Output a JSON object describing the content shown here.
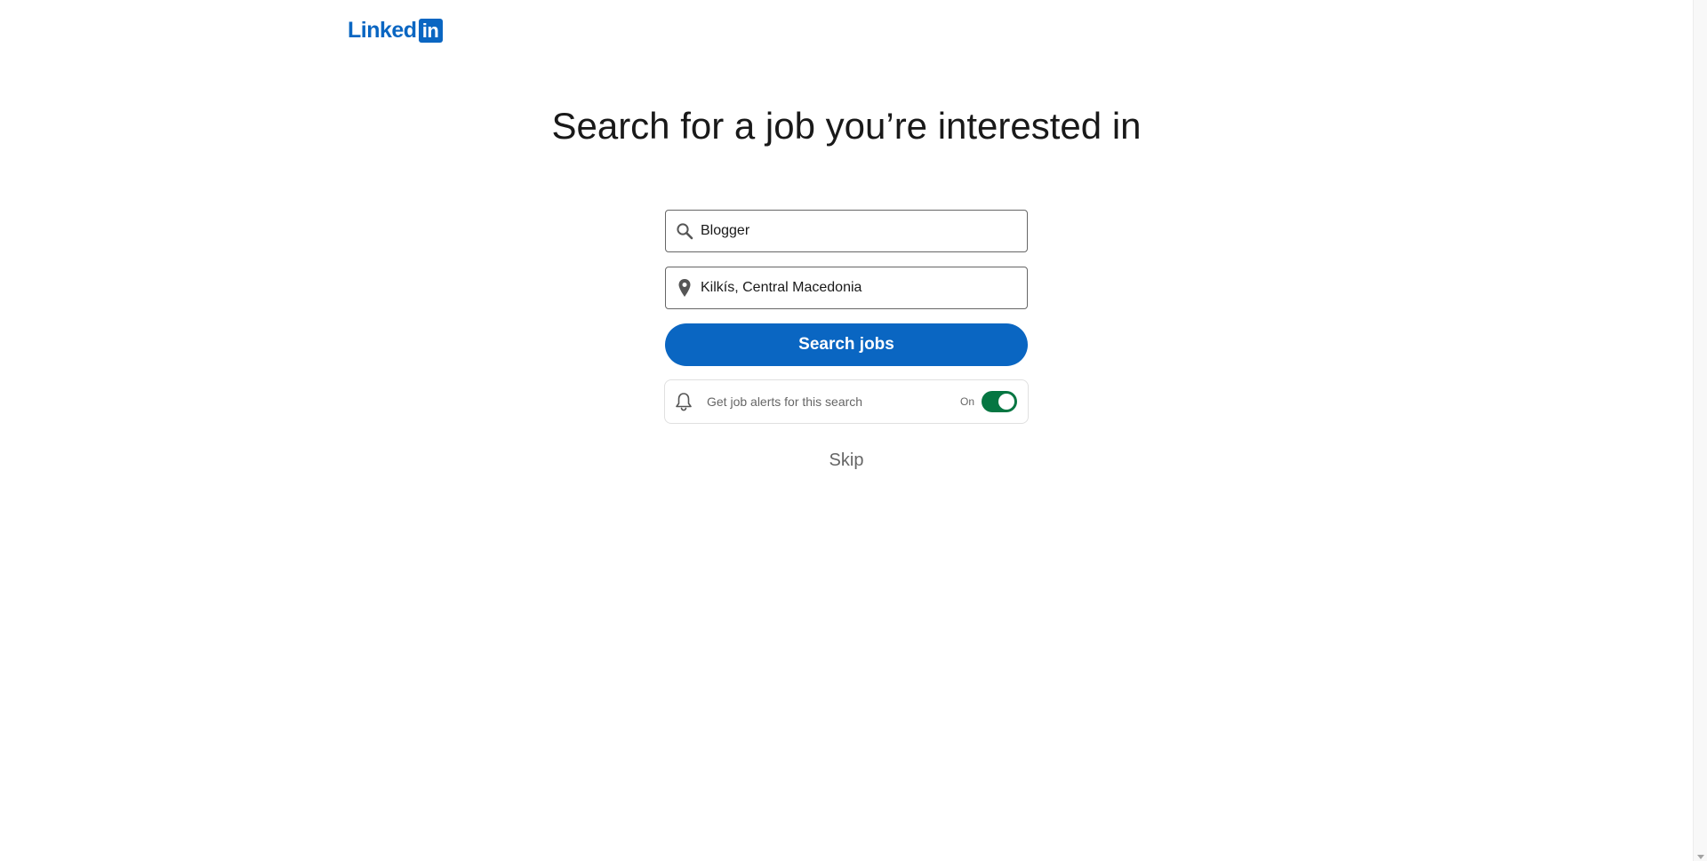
{
  "header": {
    "logo_word": "Linked",
    "logo_box": "in"
  },
  "main": {
    "heading": "Search for a job you’re interested in",
    "keyword_field": {
      "value": "Blogger",
      "icon": "search-icon"
    },
    "location_field": {
      "value": "Kilkís, Central Macedonia",
      "icon": "location-pin-icon"
    },
    "search_button_label": "Search jobs",
    "alerts": {
      "label": "Get job alerts for this search",
      "toggle_state_label": "On",
      "toggle_on": true,
      "icon": "bell-icon"
    },
    "skip_label": "Skip"
  },
  "colors": {
    "brand": "#0a66c2",
    "toggle_on": "#057642",
    "muted_text": "#666666"
  }
}
